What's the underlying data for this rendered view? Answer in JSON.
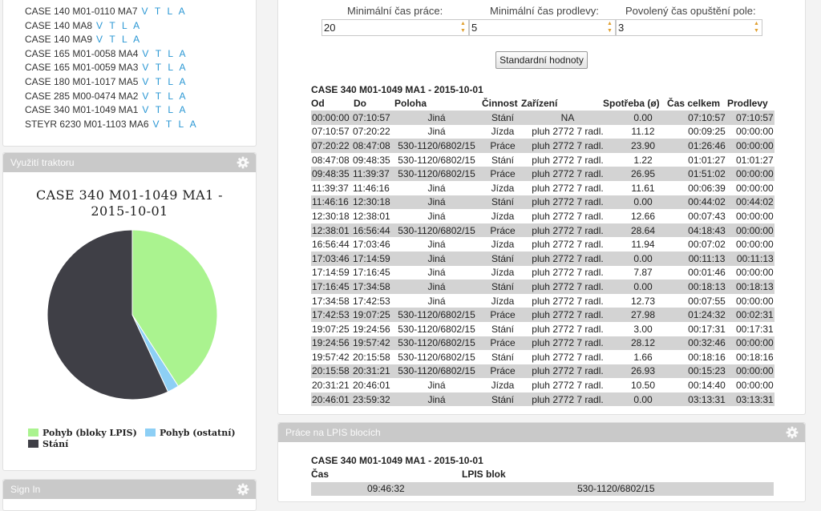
{
  "tractor_list": {
    "links_label": "V T L A",
    "items": [
      "CASE 140 M01-0110 MA7",
      "CASE 140 MA8",
      "CASE 140 MA9",
      "CASE 165 M01-0058 MA4",
      "CASE 165 M01-0059 MA3",
      "CASE 180 M01-1017 MA5",
      "CASE 285 M00-0474 MA2",
      "CASE 340 M01-1049 MA1",
      "STEYR 6230 M01-1103 MA6"
    ]
  },
  "usage_panel": {
    "title": "Využití traktoru",
    "chart_title_line1": "CASE 340 M01-1049 MA1 -",
    "chart_title_line2": "2015-10-01"
  },
  "chart_data": {
    "type": "pie",
    "title": "CASE 340 M01-1049 MA1 - 2015-10-01",
    "series": [
      {
        "name": "Pohyb (bloky LPIS)",
        "value": 40.9,
        "color": "#aaf38f"
      },
      {
        "name": "Pohyb (ostatní)",
        "value": 2.2,
        "color": "#8dcff5"
      },
      {
        "name": "Stání",
        "value": 56.9,
        "color": "#3f3f46"
      }
    ],
    "legend_position": "bottom-left"
  },
  "signin_panel": {
    "title": "Sign In"
  },
  "settings": {
    "min_work_label": "Minimální čas práce:",
    "min_work_value": "20",
    "min_idle_label": "Minimální čas prodlevy:",
    "min_idle_value": "5",
    "allowed_leave_label": "Povolený čas opuštění pole:",
    "allowed_leave_value": "3",
    "defaults_button": "Standardní hodnoty"
  },
  "log_table": {
    "title": "CASE 340 M01-1049 MA1 - 2015-10-01",
    "headers": [
      "Od",
      "Do",
      "Poloha",
      "Činnost",
      "Zařízení",
      "Spotřeba (ø)",
      "Čas celkem",
      "Prodlevy"
    ],
    "rows": [
      [
        "00:00:00",
        "07:10:57",
        "Jiná",
        "Stání",
        "NA",
        "0.00",
        "07:10:57",
        "07:10:57"
      ],
      [
        "07:10:57",
        "07:20:22",
        "Jiná",
        "Jízda",
        "pluh 2772 7 radl.",
        "11.12",
        "00:09:25",
        "00:00:00"
      ],
      [
        "07:20:22",
        "08:47:08",
        "530-1120/6802/15",
        "Práce",
        "pluh 2772 7 radl.",
        "23.90",
        "01:26:46",
        "00:00:00"
      ],
      [
        "08:47:08",
        "09:48:35",
        "530-1120/6802/15",
        "Stání",
        "pluh 2772 7 radl.",
        "1.22",
        "01:01:27",
        "01:01:27"
      ],
      [
        "09:48:35",
        "11:39:37",
        "530-1120/6802/15",
        "Práce",
        "pluh 2772 7 radl.",
        "26.95",
        "01:51:02",
        "00:00:00"
      ],
      [
        "11:39:37",
        "11:46:16",
        "Jiná",
        "Jízda",
        "pluh 2772 7 radl.",
        "11.61",
        "00:06:39",
        "00:00:00"
      ],
      [
        "11:46:16",
        "12:30:18",
        "Jiná",
        "Stání",
        "pluh 2772 7 radl.",
        "0.00",
        "00:44:02",
        "00:44:02"
      ],
      [
        "12:30:18",
        "12:38:01",
        "Jiná",
        "Jízda",
        "pluh 2772 7 radl.",
        "12.66",
        "00:07:43",
        "00:00:00"
      ],
      [
        "12:38:01",
        "16:56:44",
        "530-1120/6802/15",
        "Práce",
        "pluh 2772 7 radl.",
        "28.64",
        "04:18:43",
        "00:00:00"
      ],
      [
        "16:56:44",
        "17:03:46",
        "Jiná",
        "Jízda",
        "pluh 2772 7 radl.",
        "11.94",
        "00:07:02",
        "00:00:00"
      ],
      [
        "17:03:46",
        "17:14:59",
        "Jiná",
        "Stání",
        "pluh 2772 7 radl.",
        "0.00",
        "00:11:13",
        "00:11:13"
      ],
      [
        "17:14:59",
        "17:16:45",
        "Jiná",
        "Jízda",
        "pluh 2772 7 radl.",
        "7.87",
        "00:01:46",
        "00:00:00"
      ],
      [
        "17:16:45",
        "17:34:58",
        "Jiná",
        "Stání",
        "pluh 2772 7 radl.",
        "0.00",
        "00:18:13",
        "00:18:13"
      ],
      [
        "17:34:58",
        "17:42:53",
        "Jiná",
        "Jízda",
        "pluh 2772 7 radl.",
        "12.73",
        "00:07:55",
        "00:00:00"
      ],
      [
        "17:42:53",
        "19:07:25",
        "530-1120/6802/15",
        "Práce",
        "pluh 2772 7 radl.",
        "27.98",
        "01:24:32",
        "00:02:31"
      ],
      [
        "19:07:25",
        "19:24:56",
        "530-1120/6802/15",
        "Stání",
        "pluh 2772 7 radl.",
        "3.00",
        "00:17:31",
        "00:17:31"
      ],
      [
        "19:24:56",
        "19:57:42",
        "530-1120/6802/15",
        "Práce",
        "pluh 2772 7 radl.",
        "28.12",
        "00:32:46",
        "00:00:00"
      ],
      [
        "19:57:42",
        "20:15:58",
        "530-1120/6802/15",
        "Stání",
        "pluh 2772 7 radl.",
        "1.66",
        "00:18:16",
        "00:18:16"
      ],
      [
        "20:15:58",
        "20:31:21",
        "530-1120/6802/15",
        "Práce",
        "pluh 2772 7 radl.",
        "26.93",
        "00:15:23",
        "00:00:00"
      ],
      [
        "20:31:21",
        "20:46:01",
        "Jiná",
        "Jízda",
        "pluh 2772 7 radl.",
        "10.50",
        "00:14:40",
        "00:00:00"
      ],
      [
        "20:46:01",
        "23:59:32",
        "Jiná",
        "Stání",
        "pluh 2772 7 radl.",
        "0.00",
        "03:13:31",
        "03:13:31"
      ]
    ]
  },
  "lpis_panel": {
    "title": "Práce na LPIS blocích",
    "subtitle": "CASE 340 M01-1049 MA1 - 2015-10-01",
    "headers": [
      "Čas",
      "LPIS blok"
    ],
    "rows": [
      [
        "09:46:32",
        "530-1120/6802/15"
      ]
    ]
  },
  "colors": {
    "link": "#2a97d4",
    "panel_header": "#c9c9c9",
    "row_stripe": "#d3d3d3"
  }
}
